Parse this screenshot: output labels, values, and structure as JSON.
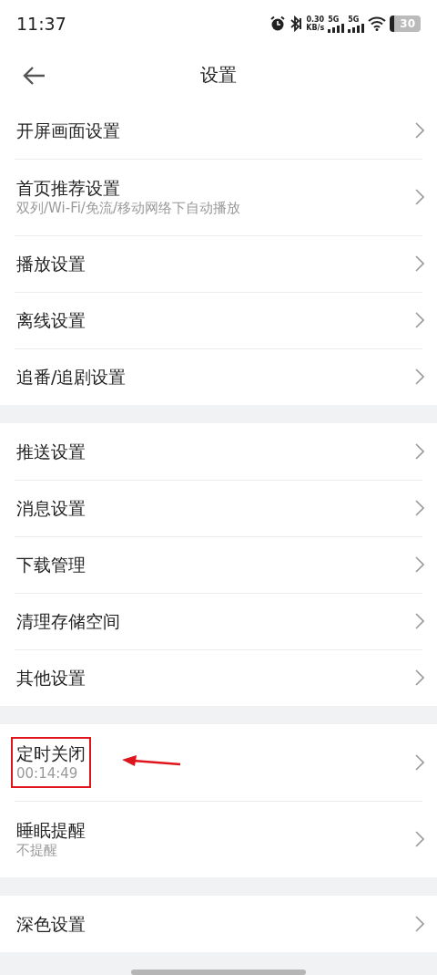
{
  "status_bar": {
    "time": "11:37",
    "speed_value": "0.30",
    "speed_unit": "KB/s",
    "sim_1": "5G",
    "sim_2": "5G",
    "battery": "30"
  },
  "header": {
    "title": "设置"
  },
  "groups": [
    {
      "items": [
        {
          "title": "开屏画面设置"
        },
        {
          "title": "首页推荐设置",
          "subtitle": "双列/Wi-Fi/免流/移动网络下自动播放"
        },
        {
          "title": "播放设置"
        },
        {
          "title": "离线设置"
        },
        {
          "title": "追番/追剧设置"
        }
      ]
    },
    {
      "items": [
        {
          "title": "推送设置"
        },
        {
          "title": "消息设置"
        },
        {
          "title": "下载管理"
        },
        {
          "title": "清理存储空间"
        },
        {
          "title": "其他设置"
        }
      ]
    },
    {
      "items": [
        {
          "title": "定时关闭",
          "subtitle": "00:14:49",
          "highlighted": true
        },
        {
          "title": "睡眠提醒",
          "subtitle": "不提醒"
        }
      ]
    },
    {
      "items": [
        {
          "title": "深色设置"
        }
      ]
    }
  ]
}
